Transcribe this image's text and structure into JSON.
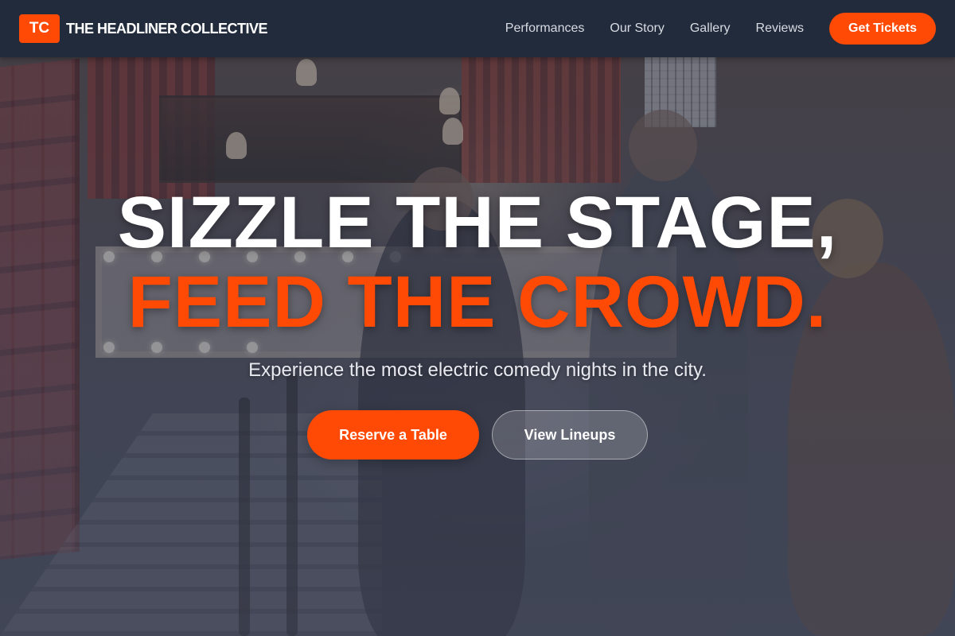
{
  "nav": {
    "logo_text": "TC",
    "brand_name": "THE HEADLINER COLLECTIVE",
    "links": [
      {
        "label": "Performances"
      },
      {
        "label": "Our Story"
      },
      {
        "label": "Gallery"
      },
      {
        "label": "Reviews"
      }
    ],
    "cta_label": "Get Tickets"
  },
  "hero": {
    "headline_line1": "SIZZLE THE STAGE,",
    "headline_line2": "FEED THE CROWD.",
    "subtitle": "Experience the most electric comedy nights in the city.",
    "primary_button": "Reserve a Table",
    "secondary_button": "View Lineups"
  },
  "colors": {
    "accent": "#ff4a06",
    "nav_background": "#222b3b",
    "text_light": "#ffffff"
  }
}
